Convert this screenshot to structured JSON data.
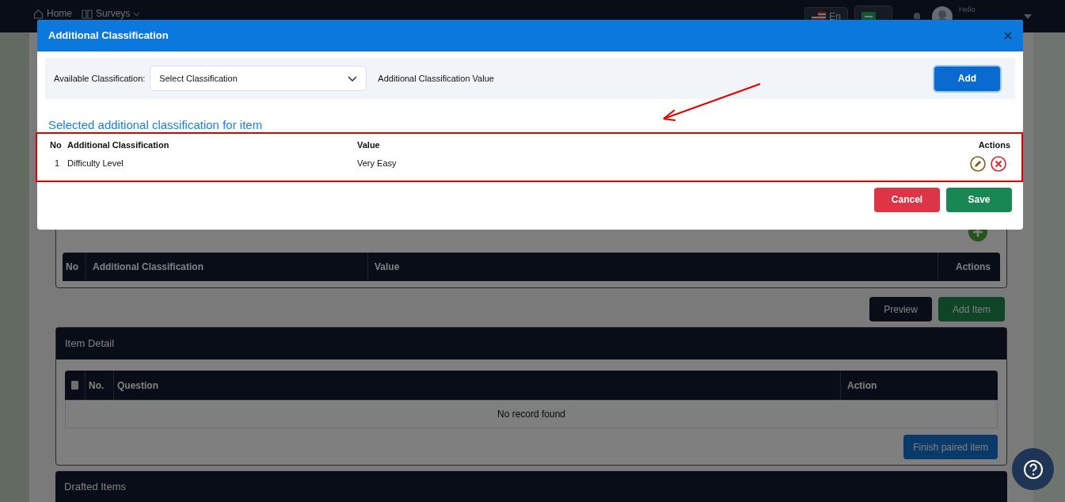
{
  "nav": {
    "items": [
      {
        "label": "Home",
        "kind": "home"
      },
      {
        "label": "Surveys",
        "kind": "surveys"
      }
    ],
    "language": "En",
    "greeting": "Hello"
  },
  "modal": {
    "title": "Additional Classification",
    "form": {
      "label": "Available Classification:",
      "select_value": "Select Classification",
      "value_label": "Additional Classification Value",
      "add_button": "Add"
    },
    "section_title": "Selected additional classification for item",
    "table": {
      "columns": [
        "No",
        "Additional Classification",
        "Value",
        "Actions"
      ],
      "rows": [
        {
          "no": "1",
          "classification": "Difficulty Level",
          "value": "Very Easy"
        }
      ]
    },
    "buttons": [
      {
        "label": "Cancel",
        "kind": "cancel"
      },
      {
        "label": "Save",
        "kind": "save"
      }
    ]
  },
  "page": {
    "classification_table": {
      "columns": [
        "No",
        "Additional Classification",
        "Value",
        "Actions"
      ]
    },
    "buttons": [
      {
        "label": "Preview",
        "kind": "dark"
      },
      {
        "label": "Add Item",
        "kind": "green"
      }
    ],
    "item_detail": {
      "title": "Item Detail",
      "select_all_checked": false,
      "columns": [
        "No.",
        "Question",
        "Action"
      ],
      "empty": "No record found",
      "button": "Finish paired item"
    },
    "drafted_title": "Drafted Items"
  }
}
